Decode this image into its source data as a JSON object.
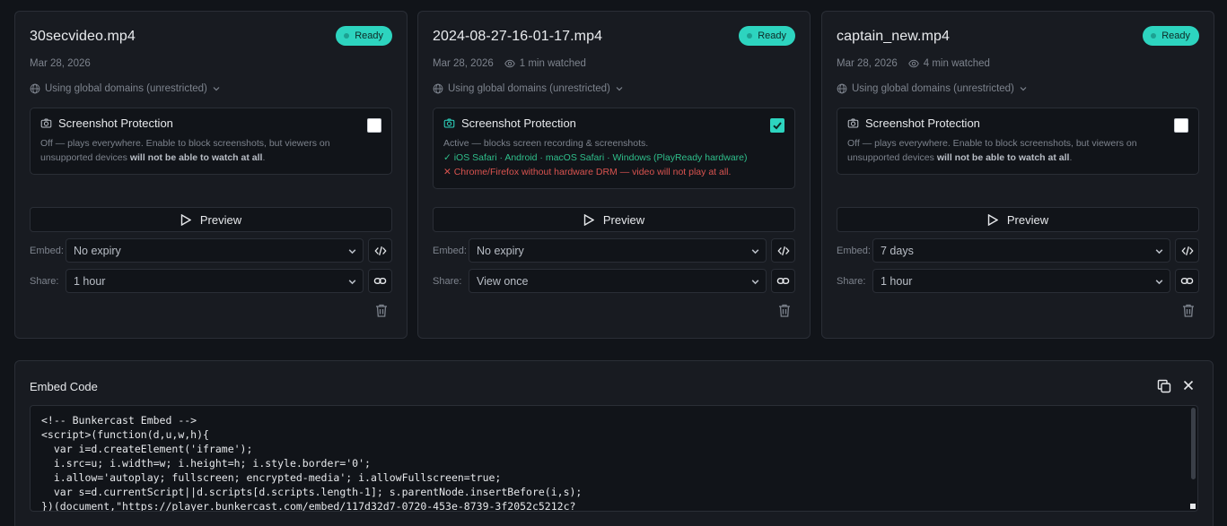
{
  "videos": [
    {
      "title": "30secvideo.mp4",
      "status": "Ready",
      "date": "Mar 28, 2026",
      "watched": "",
      "domains": "Using global domains (unrestricted)",
      "protection_label": "Screenshot Protection",
      "protection_checked": false,
      "desc_main": "Off — plays everywhere. Enable to block screenshots, but viewers on unsupported devices ",
      "desc_bold": "will not be able to watch at all",
      "desc_end": ".",
      "preview_label": "Preview",
      "embed_label": "Embed:",
      "embed_value": "No expiry",
      "share_label": "Share:",
      "share_value": "1 hour"
    },
    {
      "title": "2024-08-27-16-01-17.mp4",
      "status": "Ready",
      "date": "Mar 28, 2026",
      "watched": "1 min watched",
      "domains": "Using global domains (unrestricted)",
      "protection_label": "Screenshot Protection",
      "protection_checked": true,
      "desc_main": "Active — blocks screen recording & screenshots.",
      "ok_line": "✓ iOS Safari · Android · macOS Safari · Windows (PlayReady hardware)",
      "bad_line": "✕ Chrome/Firefox without hardware DRM — video will not play at all.",
      "preview_label": "Preview",
      "embed_label": "Embed:",
      "embed_value": "No expiry",
      "share_label": "Share:",
      "share_value": "View once"
    },
    {
      "title": "captain_new.mp4",
      "status": "Ready",
      "date": "Mar 28, 2026",
      "watched": "4 min watched",
      "domains": "Using global domains (unrestricted)",
      "protection_label": "Screenshot Protection",
      "protection_checked": false,
      "desc_main": "Off — plays everywhere. Enable to block screenshots, but viewers on unsupported devices ",
      "desc_bold": "will not be able to watch at all",
      "desc_end": ".",
      "preview_label": "Preview",
      "embed_label": "Embed:",
      "embed_value": "7 days",
      "share_label": "Share:",
      "share_value": "1 hour"
    }
  ],
  "embed_panel": {
    "title": "Embed Code",
    "code": "<!-- Bunkercast Embed -->\n<script>(function(d,u,w,h){\n  var i=d.createElement('iframe');\n  i.src=u; i.width=w; i.height=h; i.style.border='0';\n  i.allow='autoplay; fullscreen; encrypted-media'; i.allowFullscreen=true;\n  var s=d.currentScript||d.scripts[d.scripts.length-1]; s.parentNode.insertBefore(i,s);\n})(document,\"https://player.bunkercast.com/embed/117d32d7-0720-453e-8739-3f2052c5212c?"
  },
  "icons": {
    "camera": "camera-icon",
    "eye": "eye-icon",
    "globe": "globe-icon",
    "play": "play-icon",
    "code": "code-icon",
    "link": "link-icon",
    "trash": "trash-icon",
    "copy": "copy-icon",
    "close": "close-icon"
  },
  "colors": {
    "accent": "#2dd4bf",
    "background": "#111419",
    "card": "#181b21",
    "ok": "#2fbf8b",
    "bad": "#d9534f"
  }
}
